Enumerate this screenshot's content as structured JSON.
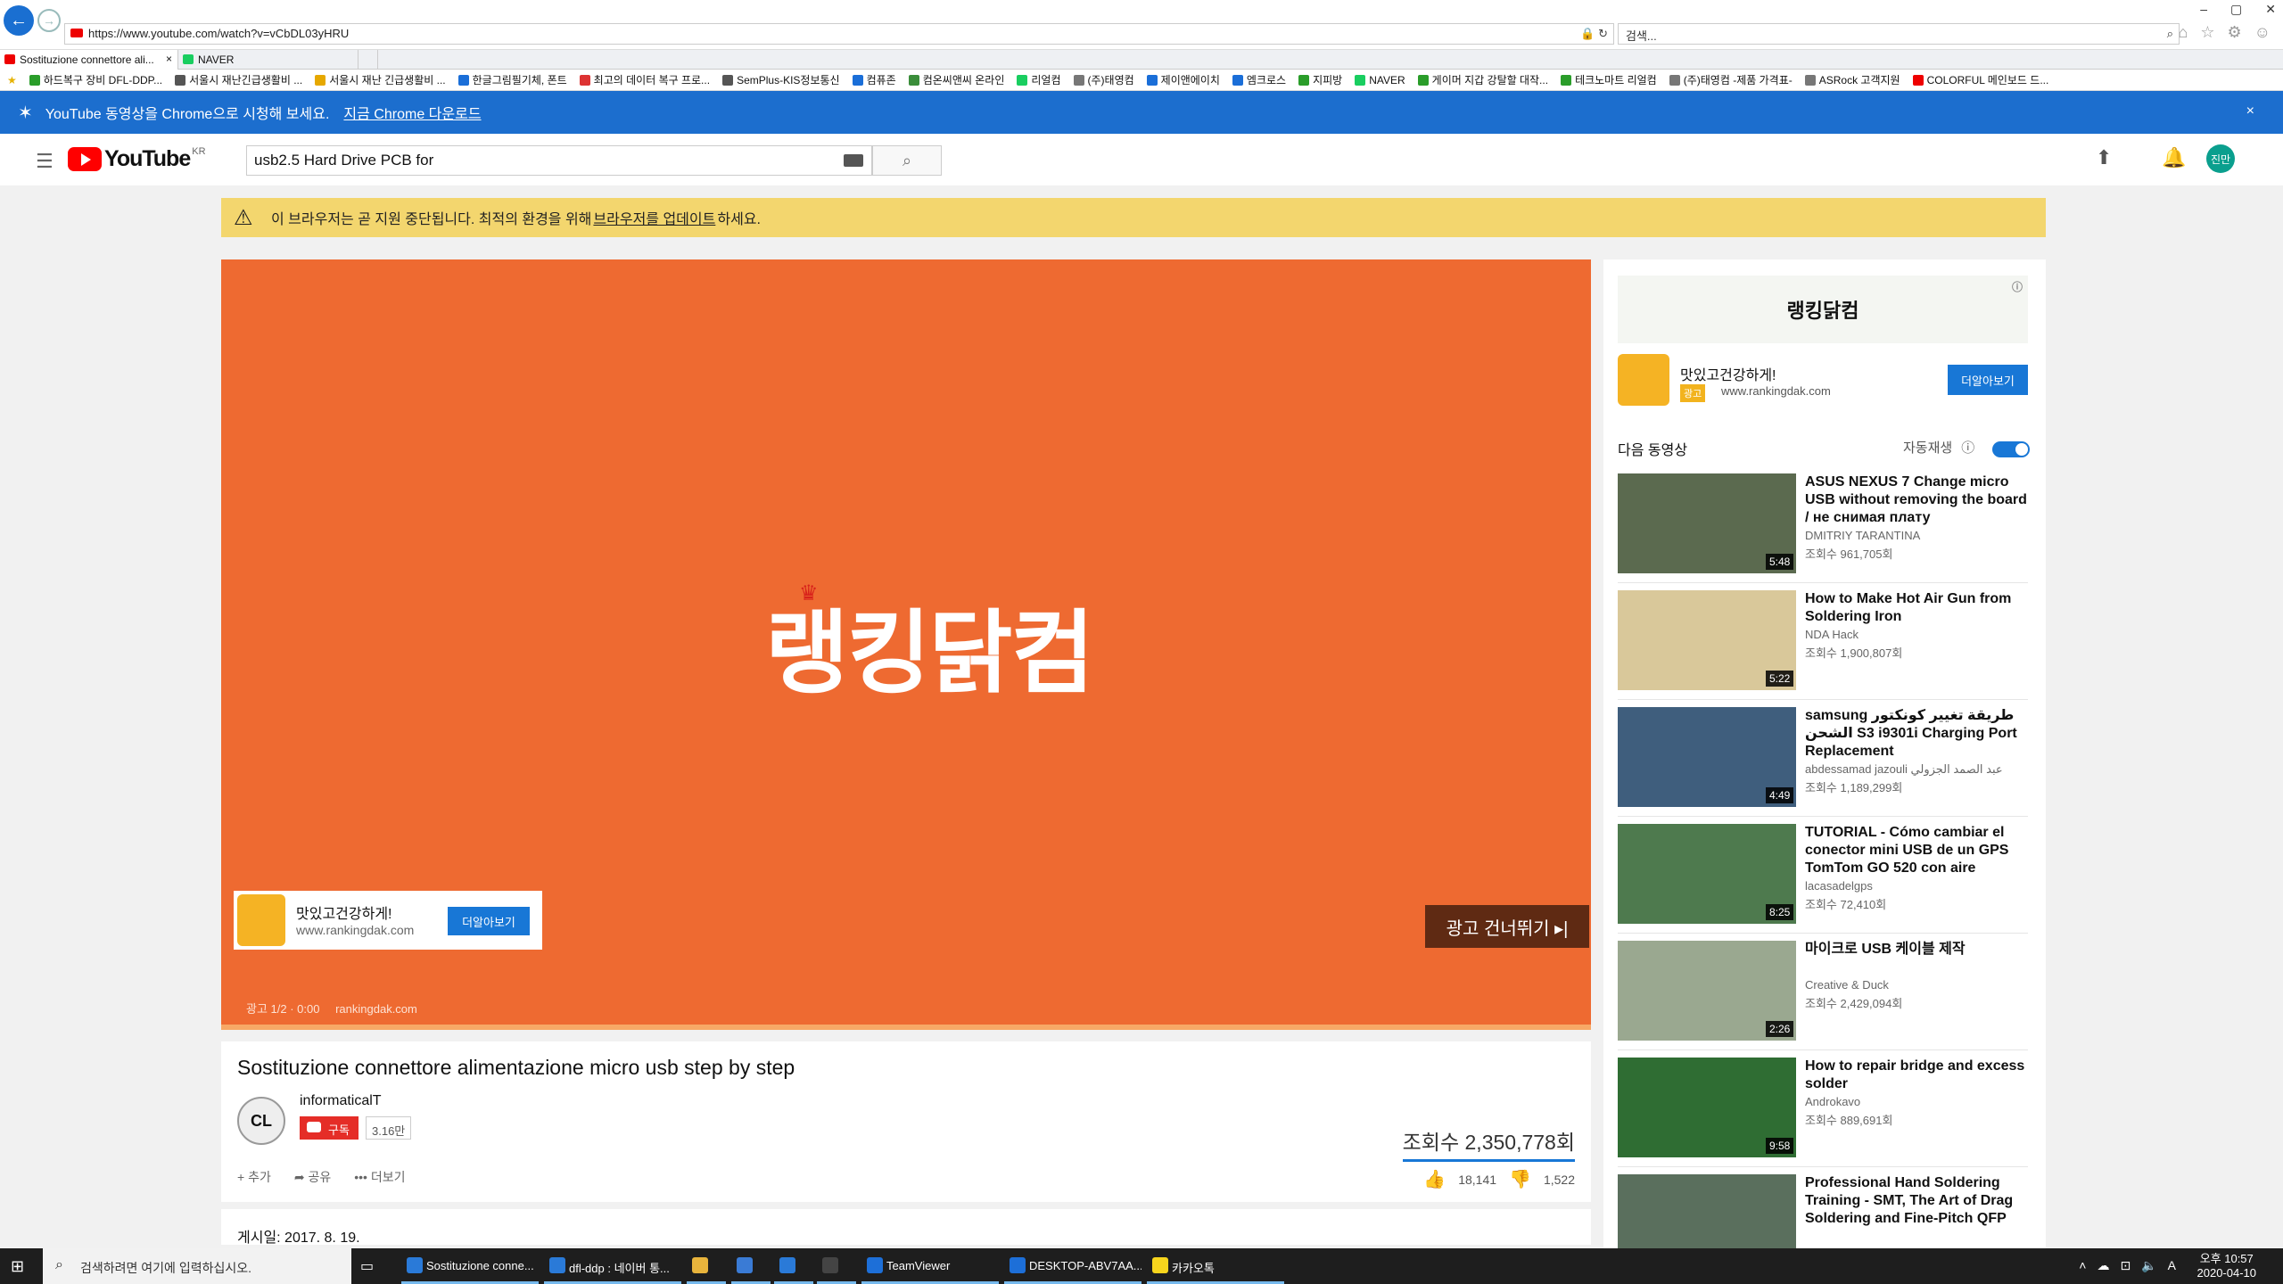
{
  "browser": {
    "url": "https://www.youtube.com/watch?v=vCbDL03yHRU",
    "search_placeholder": "검색...",
    "window_buttons": [
      "–",
      "▢",
      "✕"
    ],
    "tabs": [
      {
        "label": "Sostituzione connettore ali..."
      },
      {
        "label": "NAVER"
      }
    ],
    "favorites": [
      "하드복구 장비 DFL-DDP...",
      "서울시 재난긴급생활비 ...",
      "서울시 재난 긴급생활비 ...",
      "한글그림필기체, 폰트",
      "최고의 데이터 복구 프로...",
      "SemPlus-KIS정보통신",
      "컴퓨존",
      "컴온씨앤씨 온라인",
      "리얼컴",
      "(주)태영컴",
      "제이앤에이치",
      "엠크로스",
      "지피방",
      "NAVER",
      "게이머 지갑 강탈할 대작...",
      "테크노마트 리얼컴",
      "(주)태영컴 -제품 가격표-",
      "ASRock 고객지원",
      "COLORFUL 메인보드 드..."
    ]
  },
  "chrome_banner": {
    "text": "YouTube 동영상을 Chrome으로 시청해 보세요.",
    "link": "지금 Chrome 다운로드",
    "close": "×"
  },
  "header": {
    "logo": "YouTube",
    "region": "KR",
    "search_value": "usb2.5 Hard Drive PCB for",
    "avatar": "진만"
  },
  "warning": {
    "text_before": "이 브라우저는 곧 지원 중단됩니다. 최적의 환경을 위해 ",
    "link": "브라우저를 업데이트",
    "text_after": "하세요."
  },
  "player": {
    "ad_logo": "랭킹닭컴",
    "card_title": "맛있고건강하게!",
    "card_url": "www.rankingdak.com",
    "card_button": "더알아보기",
    "skip": "광고 건너뛰기 ▸|",
    "ad_counter": "광고 1/2 · 0:00",
    "ad_domain": "rankingdak.com"
  },
  "video": {
    "title": "Sostituzione connettore alimentazione micro usb step by step",
    "channel_logo": "CL",
    "channel": "informaticalT",
    "subscribe": "구독",
    "subscribers": "3.16만",
    "views": "조회수 2,350,778회",
    "actions": [
      "+ 추가",
      "➦ 공유",
      "••• 더보기"
    ],
    "likes": "18,141",
    "dislikes": "1,522",
    "published": "게시일: 2017. 8. 19."
  },
  "sidebar": {
    "ad_banner": "랭킹닭컴",
    "ad_title": "맛있고건강하게!",
    "ad_label": "광고",
    "ad_url": "www.rankingdak.com",
    "ad_button": "더알아보기",
    "up_next": "다음 동영상",
    "autoplay": "자동재생",
    "items": [
      {
        "title": "ASUS NEXUS 7 Change micro USB without removing the board / не снимая плату",
        "channel": "DMITRIY TARANTINA",
        "views": "조회수 961,705회",
        "duration": "5:48",
        "color": "#5b6a4f"
      },
      {
        "title": "How to Make Hot Air Gun from Soldering Iron",
        "channel": "NDA Hack",
        "views": "조회수 1,900,807회",
        "duration": "5:22",
        "color": "#d9c89a"
      },
      {
        "title": "samsung طريقة تغيير كونكتور الشحن S3 i9301i Charging Port Replacement",
        "channel": "abdessamad jazouli عبد الصمد الجزولي",
        "views": "조회수 1,189,299회",
        "duration": "4:49",
        "color": "#3f5e7d"
      },
      {
        "title": "TUTORIAL - Cómo cambiar el conector mini USB de un GPS TomTom GO 520 con aire",
        "channel": "lacasadelgps",
        "views": "조회수 72,410회",
        "duration": "8:25",
        "color": "#4e7a4e"
      },
      {
        "title": "마이크로 USB 케이블 제작",
        "channel": "Creative & Duck",
        "views": "조회수 2,429,094회",
        "duration": "2:26",
        "color": "#9aa890"
      },
      {
        "title": "How to repair bridge and excess solder",
        "channel": "Androkavo",
        "views": "조회수 889,691회",
        "duration": "9:58",
        "color": "#2f6d33"
      },
      {
        "title": "Professional Hand Soldering Training - SMT, The Art of Drag Soldering and Fine-Pitch QFP",
        "channel": "",
        "views": "",
        "duration": "",
        "color": "#5a6f5d"
      }
    ]
  },
  "taskbar": {
    "search": "검색하려면 여기에 입력하십시오.",
    "apps": [
      {
        "label": "Sostituzione conne...",
        "color": "#2a7ad8"
      },
      {
        "label": "dfl-ddp : 네이버 통...",
        "color": "#2a7ad8"
      },
      {
        "label": "",
        "color": "#e8b43c"
      },
      {
        "label": "",
        "color": "#3a7bd5"
      },
      {
        "label": "",
        "color": "#2a7ad8"
      },
      {
        "label": "",
        "color": "#444"
      },
      {
        "label": "TeamViewer",
        "color": "#1d6fd8"
      },
      {
        "label": "DESKTOP-ABV7AA...",
        "color": "#1d6fd8"
      },
      {
        "label": "카카오톡",
        "color": "#f7d51d"
      }
    ],
    "time": "오후 10:57",
    "date": "2020-04-10"
  }
}
